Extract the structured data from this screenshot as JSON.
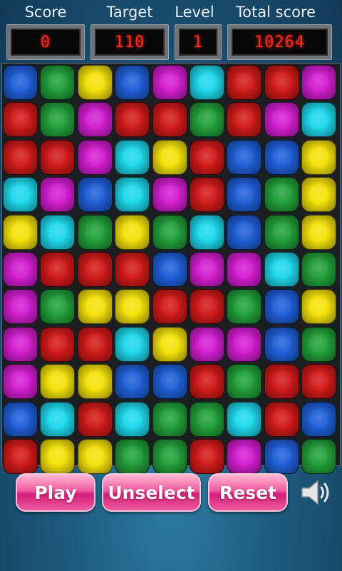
{
  "header": {
    "score_label": "Score",
    "target_label": "Target",
    "level_label": "Level",
    "total_label": "Total score",
    "score_value": "0",
    "target_value": "110",
    "level_value": "1",
    "total_value": "10264"
  },
  "colors": {
    "B": "#1f5fd8",
    "G": "#22a03a",
    "Y": "#f4e20a",
    "M": "#d31ed0",
    "C": "#1ed8ec",
    "R": "#d21a1a"
  },
  "board": {
    "rows": [
      [
        "B",
        "G",
        "Y",
        "B",
        "M",
        "C",
        "R",
        "R",
        "M"
      ],
      [
        "R",
        "G",
        "M",
        "R",
        "R",
        "G",
        "R",
        "M",
        "C"
      ],
      [
        "R",
        "R",
        "M",
        "C",
        "Y",
        "R",
        "B",
        "B",
        "Y"
      ],
      [
        "C",
        "M",
        "B",
        "C",
        "M",
        "R",
        "B",
        "G",
        "Y"
      ],
      [
        "Y",
        "C",
        "G",
        "Y",
        "G",
        "C",
        "B",
        "G",
        "Y"
      ],
      [
        "M",
        "R",
        "R",
        "R",
        "B",
        "M",
        "M",
        "C",
        "G"
      ],
      [
        "M",
        "G",
        "Y",
        "Y",
        "R",
        "R",
        "G",
        "B",
        "Y"
      ],
      [
        "M",
        "R",
        "R",
        "C",
        "Y",
        "M",
        "M",
        "B",
        "G"
      ],
      [
        "M",
        "Y",
        "Y",
        "B",
        "B",
        "R",
        "G",
        "R",
        "R"
      ],
      [
        "B",
        "C",
        "R",
        "C",
        "G",
        "G",
        "C",
        "R",
        "B"
      ],
      [
        "R",
        "Y",
        "Y",
        "G",
        "G",
        "R",
        "M",
        "B",
        "G"
      ]
    ]
  },
  "controls": {
    "play_label": "Play",
    "unselect_label": "Unselect",
    "reset_label": "Reset",
    "sound_icon": "speaker-icon"
  }
}
